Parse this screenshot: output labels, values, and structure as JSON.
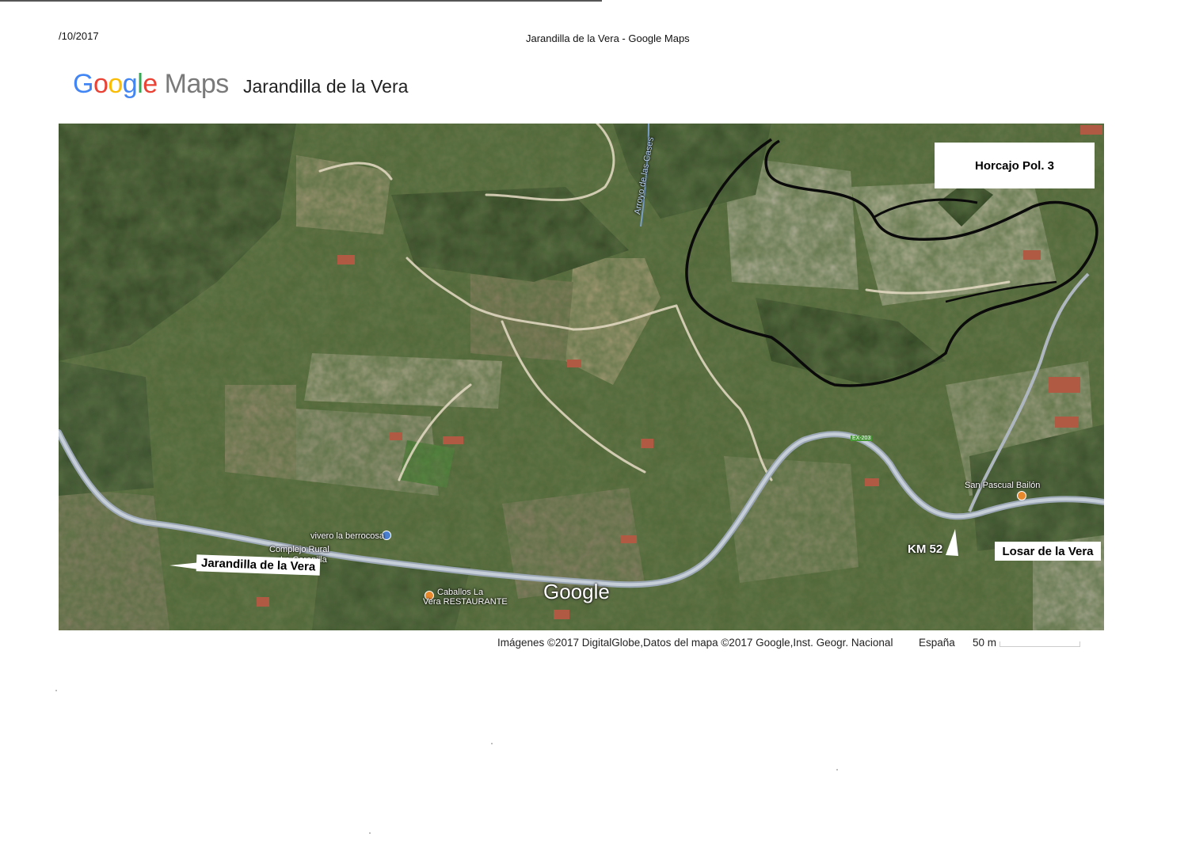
{
  "print_header": {
    "date": "/10/2017",
    "title": "Jarandilla de la Vera - Google Maps"
  },
  "logo": {
    "google": "Google",
    "maps": "Maps",
    "colors": {
      "blue": "#4285F4",
      "red": "#EA4335",
      "yellow": "#FBBC05",
      "green": "#34A853",
      "gray": "#7a7a7a"
    }
  },
  "place_title": "Jarandilla de la Vera",
  "map": {
    "style": "satellite",
    "stream_label": "Arroyo de las Cases",
    "pois": {
      "vivero": "vivero la berrocosa",
      "complejo_line1": "Complejo Rural",
      "complejo_line2": "La Coronilla",
      "caballos_line1": "Caballos La",
      "caballos_line2": "Vera RESTAURANTE",
      "san_pascual": "San Pascual Bailón"
    },
    "road_shield": "EX-203",
    "watermark": "Google",
    "annotations": {
      "horcajo": "Horcajo Pol. 3",
      "losar": "Losar de la Vera",
      "km": "KM 52",
      "jarandilla": "Jarandilla de la Vera"
    }
  },
  "footer": {
    "attribution": "Imágenes ©2017 DigitalGlobe,Datos del mapa ©2017 Google,Inst. Geogr. Nacional",
    "country": "España",
    "scale": "50 m"
  }
}
